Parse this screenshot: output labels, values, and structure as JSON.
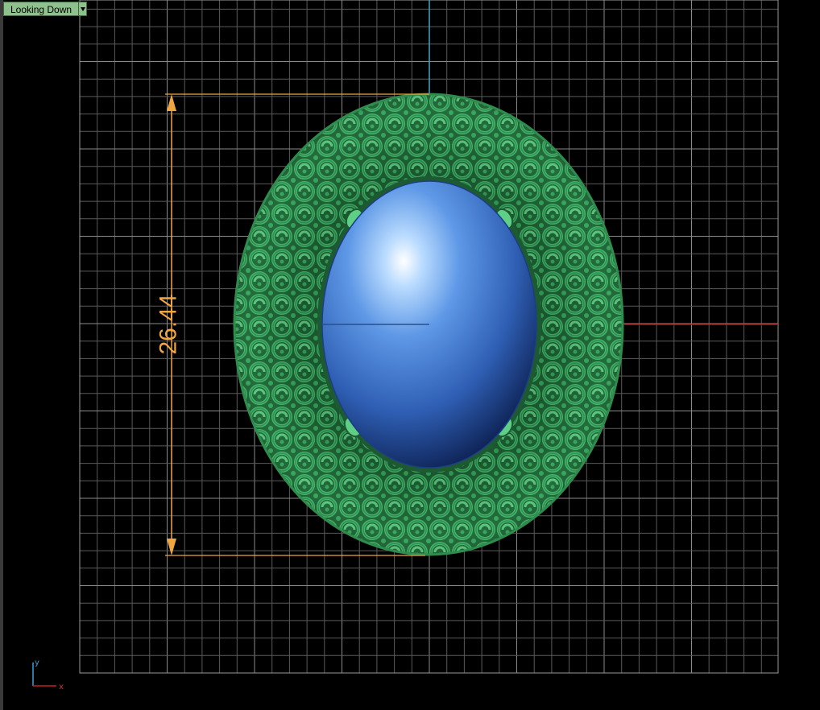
{
  "viewport": {
    "label": "Looking Down"
  },
  "dimension": {
    "value": "26.44"
  },
  "axis_widget": {
    "y_label": "y",
    "x_label": "x"
  },
  "colors": {
    "grid": "#5a5a5a",
    "grid_border": "#9a9a9a",
    "x_axis": "#b01818",
    "y_axis": "#3aa8c8",
    "dimension": "#f0a640",
    "setting": "#2f9a52",
    "stone": "#3d75d0"
  }
}
